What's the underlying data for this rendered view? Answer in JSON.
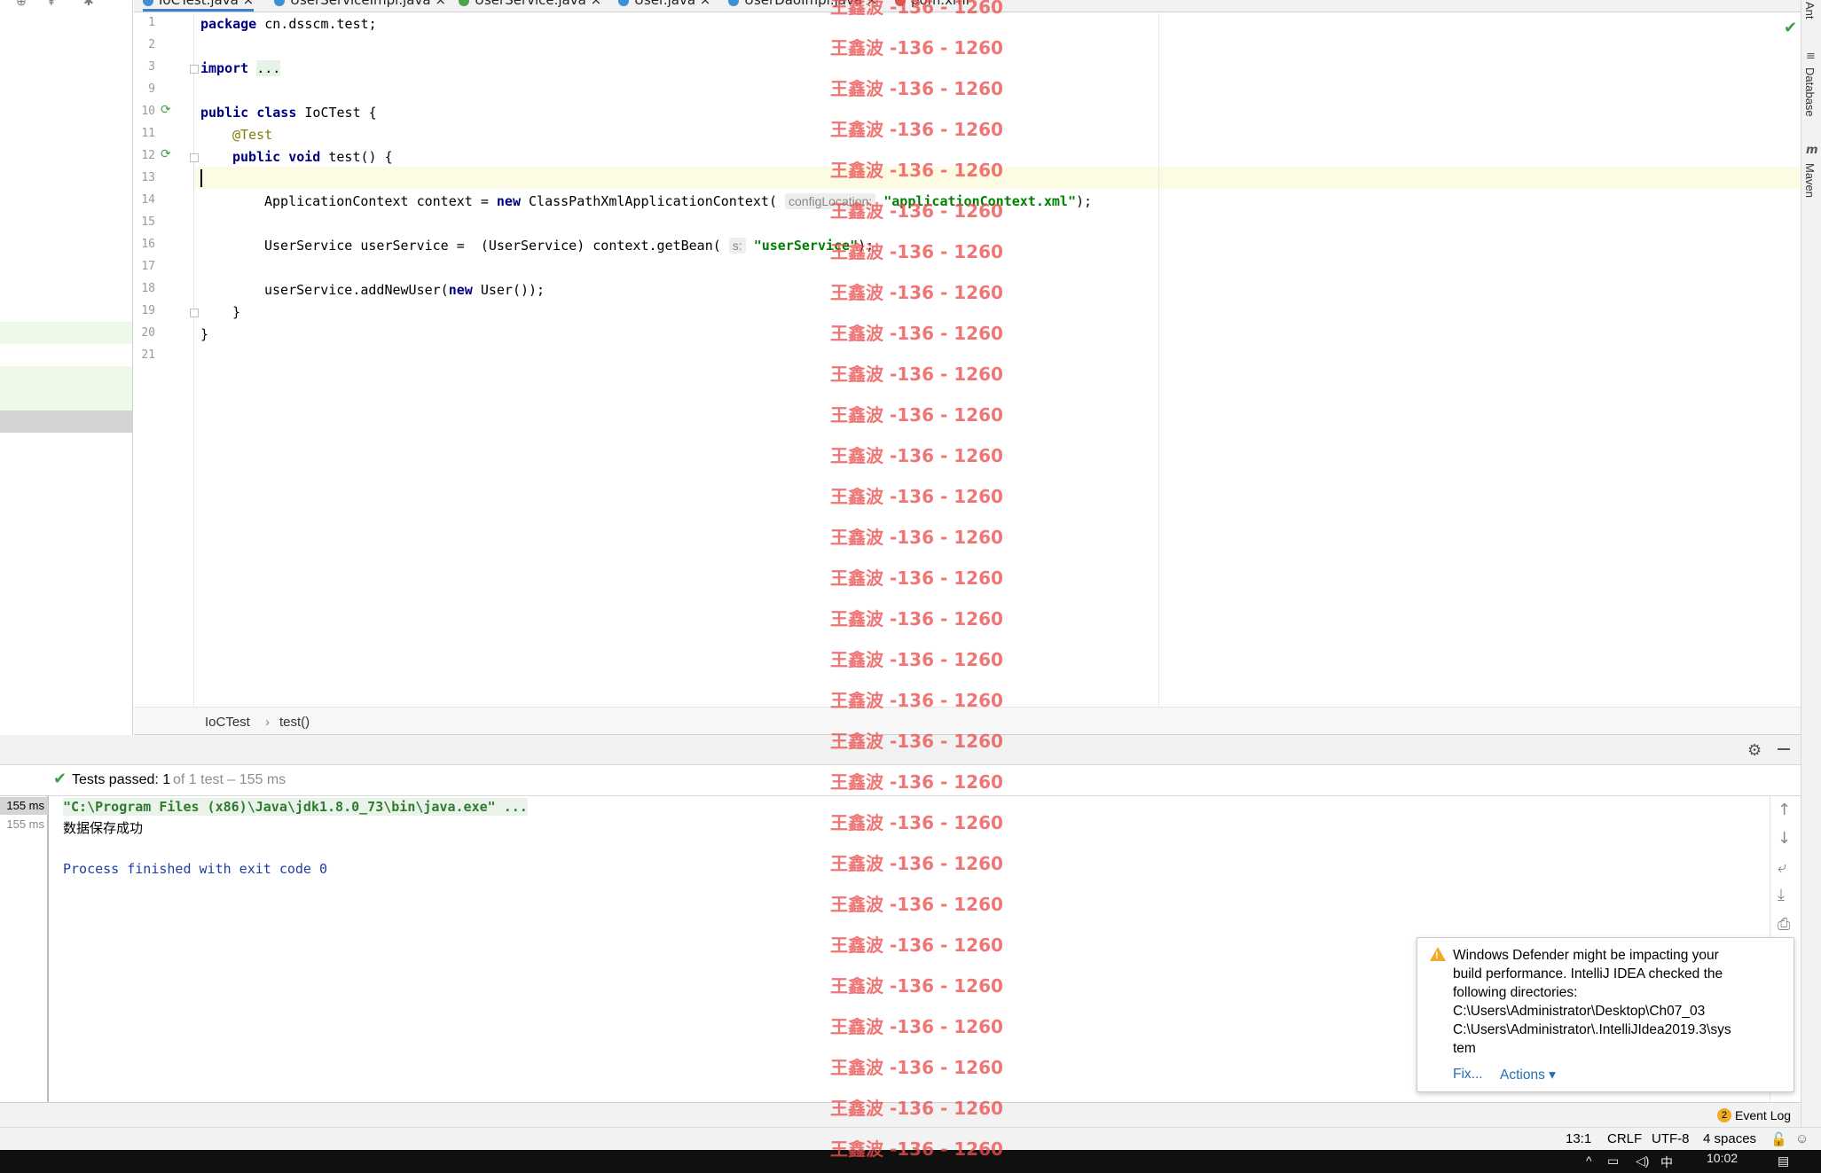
{
  "tabs": [
    {
      "label": "IoCTest.java",
      "active": true
    },
    {
      "label": "UserServiceImpl.java",
      "active": false
    },
    {
      "label": "UserService.java",
      "active": false
    },
    {
      "label": "User.java",
      "active": false
    },
    {
      "label": "UserDaoImpl.java",
      "active": false
    },
    {
      "label": "pom.xml",
      "active": false
    }
  ],
  "editor": {
    "line_numbers": [
      "1",
      "2",
      "3",
      "9",
      "10",
      "11",
      "12",
      "13",
      "14",
      "15",
      "16",
      "17",
      "18",
      "19",
      "20",
      "21"
    ],
    "package_kw": "package",
    "package_name": " cn.dsscm.test;",
    "import_kw": "import",
    "import_fold": "...",
    "public_kw": "public",
    "class_kw": "class",
    "class_name": " IoCTest {",
    "annotation": "@Test",
    "void_kw": "void",
    "method_sig": " test() {",
    "ctx_decl": "ApplicationContext context = ",
    "new_kw": "new",
    "ctx_ctor": " ClassPathXmlApplicationContext(",
    "param_hint": "configLocation:",
    "config_string": "\"applicationContext.xml\"",
    "ctx_end": ");",
    "svc_decl": "UserService userService =  (UserService) context.getBean(",
    "svc_hint": "s:",
    "svc_string": "\"userService\"",
    "svc_end": ");",
    "add_call": "userService.addNewUser(",
    "add_ctor": " User());",
    "close_method": "}",
    "close_class": "}"
  },
  "breadcrumb": {
    "class": "IoCTest",
    "separator": "›",
    "method": "test()"
  },
  "run": {
    "status_passed": "Tests passed: 1",
    "status_detail": "of 1 test – 155 ms",
    "tree_times": [
      "155 ms",
      "155 ms"
    ],
    "console_cmd": "\"C:\\Program Files (x86)\\Java\\jdk1.8.0_73\\bin\\java.exe\" ...",
    "console_output": "数据保存成功",
    "console_exit": "Process finished with exit code 0"
  },
  "notification": {
    "message": "Windows Defender might be impacting your\nbuild performance. IntelliJ IDEA checked the\nfollowing directories:\nC:\\Users\\Administrator\\Desktop\\Ch07_03\nC:\\Users\\Administrator\\.IntelliJIdea2019.3\\sys\ntem",
    "fix_link": "Fix...",
    "actions_link": "Actions ▾"
  },
  "right_strip": {
    "ant": "Ant",
    "database": "Database",
    "maven": "Maven"
  },
  "event_log": {
    "count": "2",
    "label": "Event Log"
  },
  "status_bar": {
    "position": "13:1",
    "line_sep": "CRLF",
    "encoding": "UTF-8",
    "indent": "4 spaces"
  },
  "taskbar": {
    "clock": "10:02",
    "ime": "中"
  },
  "watermark": {
    "text": "王鑫波 -136 - 1260"
  },
  "colors": {
    "keyword": "#000080",
    "string": "#008000",
    "annotation": "#808000",
    "watermark": "#ec5050",
    "link": "#2470b3"
  }
}
